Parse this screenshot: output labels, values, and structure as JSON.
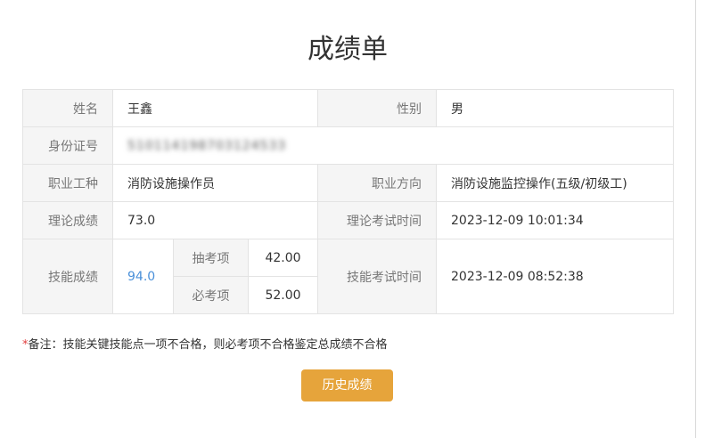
{
  "title": "成绩单",
  "labels": {
    "name": "姓名",
    "gender": "性别",
    "id_number": "身份证号",
    "occupation": "职业工种",
    "direction": "职业方向",
    "theory_score": "理论成绩",
    "theory_time": "理论考试时间",
    "skill_score": "技能成绩",
    "random_item": "抽考项",
    "required_item": "必考项",
    "skill_time": "技能考试时间"
  },
  "values": {
    "name": "王鑫",
    "gender": "男",
    "id_number": "510114198703124533",
    "occupation": "消防设施操作员",
    "direction": "消防设施监控操作(五级/初级工)",
    "theory_score": "73.0",
    "theory_time": "2023-12-09 10:01:34",
    "skill_score": "94.0",
    "random_item_score": "42.00",
    "required_item_score": "52.00",
    "skill_time": "2023-12-09 08:52:38"
  },
  "note": {
    "asterisk": "*",
    "text": "备注：技能关键技能点一项不合格，则必考项不合格鉴定总成绩不合格"
  },
  "history_button": "历史成绩",
  "colors": {
    "label_bg": "#f5f5f5",
    "border": "#e3e3e3",
    "score_link": "#4a90d9",
    "button_bg": "#e6a43b",
    "asterisk": "#e03c3c"
  }
}
